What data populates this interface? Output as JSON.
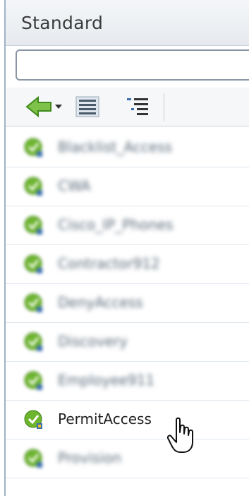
{
  "panel": {
    "title": "Standard"
  },
  "search": {
    "placeholder": "",
    "value": ""
  },
  "toolbar": {
    "buttons": [
      {
        "icon": "back-arrow-icon"
      },
      {
        "icon": "list-view-icon"
      },
      {
        "icon": "tree-view-icon"
      }
    ]
  },
  "items": [
    {
      "label": "Blacklist_Access",
      "legible": false
    },
    {
      "label": "CWA",
      "legible": false
    },
    {
      "label": "Cisco_IP_Phones",
      "legible": false
    },
    {
      "label": "Contractor912",
      "legible": false
    },
    {
      "label": "DenyAccess",
      "legible": false
    },
    {
      "label": "Discovery",
      "legible": false
    },
    {
      "label": "Employee911",
      "legible": false
    },
    {
      "label": "PermitAccess",
      "legible": true
    },
    {
      "label": "Provision",
      "legible": false
    }
  ],
  "colors": {
    "accent_green": "#5fae1f",
    "border": "#9fb3c8"
  }
}
